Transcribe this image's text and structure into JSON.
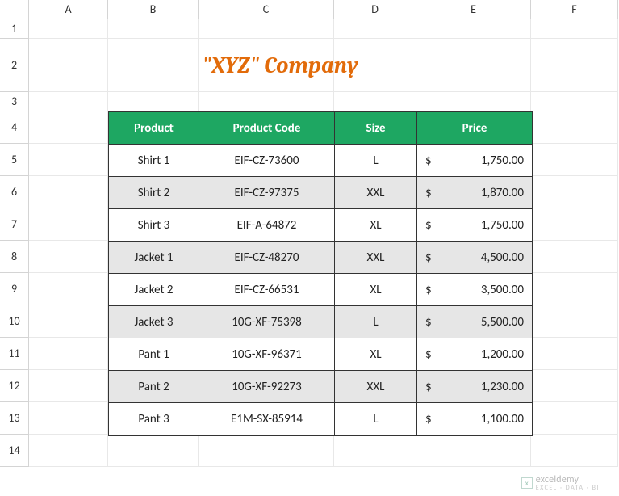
{
  "columns": [
    "A",
    "B",
    "C",
    "D",
    "E",
    "F"
  ],
  "rows": [
    "1",
    "2",
    "3",
    "4",
    "5",
    "6",
    "7",
    "8",
    "9",
    "10",
    "11",
    "12",
    "13",
    "14"
  ],
  "title": "\"XYZ\" Company",
  "headers": {
    "product": "Product",
    "code": "Product Code",
    "size": "Size",
    "price": "Price"
  },
  "currency": "$",
  "table": [
    {
      "product": "Shirt 1",
      "code": "EIF-CZ-73600",
      "size": "L",
      "price": "1,750.00",
      "alt": false
    },
    {
      "product": "Shirt 2",
      "code": "EIF-CZ-97375",
      "size": "XXL",
      "price": "1,870.00",
      "alt": true
    },
    {
      "product": "Shirt 3",
      "code": "EIF-A-64872",
      "size": "XL",
      "price": "1,750.00",
      "alt": false
    },
    {
      "product": "Jacket 1",
      "code": "EIF-CZ-48270",
      "size": "XXL",
      "price": "4,500.00",
      "alt": true
    },
    {
      "product": "Jacket 2",
      "code": "EIF-CZ-66531",
      "size": "XL",
      "price": "3,500.00",
      "alt": false
    },
    {
      "product": "Jacket 3",
      "code": "10G-XF-75398",
      "size": "L",
      "price": "5,500.00",
      "alt": true
    },
    {
      "product": "Pant 1",
      "code": "10G-XF-96371",
      "size": "XL",
      "price": "1,200.00",
      "alt": false
    },
    {
      "product": "Pant 2",
      "code": "10G-XF-92273",
      "size": "XXL",
      "price": "1,230.00",
      "alt": true
    },
    {
      "product": "Pant 3",
      "code": "E1M-SX-85914",
      "size": "L",
      "price": "1,100.00",
      "alt": false
    }
  ],
  "watermark": {
    "brand": "exceldemy",
    "sub": "EXCEL · DATA · BI",
    "icon": "x"
  }
}
